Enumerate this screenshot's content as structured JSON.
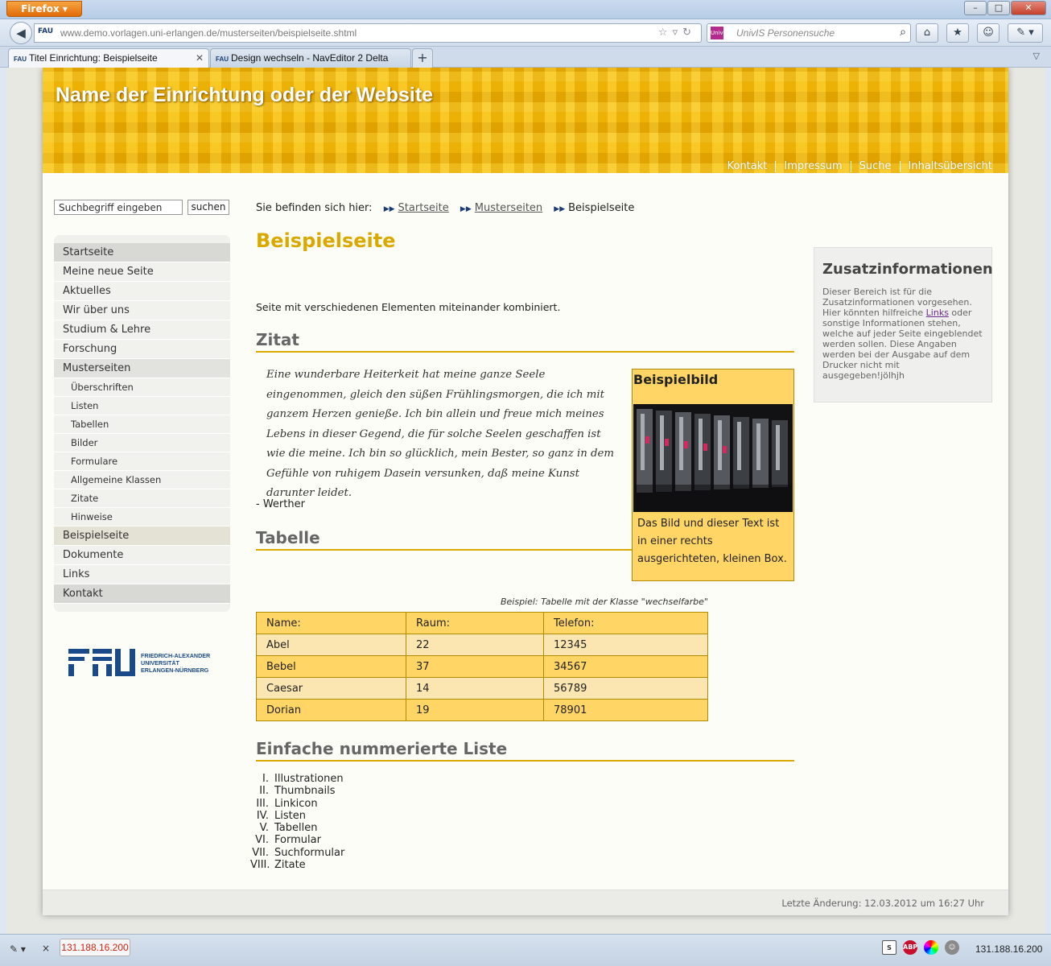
{
  "browser": {
    "menu_button": "Firefox",
    "url_favicon": "FAU",
    "url": "www.demo.vorlagen.uni-erlangen.de/musterseiten/beispielseite.shtml",
    "search_placeholder": "UnivIS Personensuche",
    "tabs": [
      {
        "favicon": "FAU",
        "label": "Titel Einrichtung: Beispielseite",
        "active": true
      },
      {
        "favicon": "FAU",
        "label": "Design wechseln - NavEditor 2 Delta",
        "active": false
      }
    ],
    "new_tab": "+",
    "window_buttons": {
      "minimize": "–",
      "maximize": "□",
      "close": "✕"
    }
  },
  "site": {
    "title": "Name der Einrichtung oder der Website",
    "metanav": [
      "Kontakt",
      "Impressum",
      "Suche",
      "Inhaltsübersicht"
    ]
  },
  "search": {
    "placeholder": "Suchbegriff eingeben",
    "button": "suchen"
  },
  "sidenav": [
    {
      "label": "Startseite",
      "level": "top"
    },
    {
      "label": "Meine neue Seite",
      "level": "main"
    },
    {
      "label": "Aktuelles",
      "level": "main"
    },
    {
      "label": "Wir über uns",
      "level": "main"
    },
    {
      "label": "Studium & Lehre",
      "level": "main"
    },
    {
      "label": "Forschung",
      "level": "main"
    },
    {
      "label": "Musterseiten",
      "level": "open"
    },
    {
      "label": "Überschriften",
      "level": "sub"
    },
    {
      "label": "Listen",
      "level": "sub"
    },
    {
      "label": "Tabellen",
      "level": "sub"
    },
    {
      "label": "Bilder",
      "level": "sub"
    },
    {
      "label": "Formulare",
      "level": "sub"
    },
    {
      "label": "Allgemeine Klassen",
      "level": "sub"
    },
    {
      "label": "Zitate",
      "level": "sub"
    },
    {
      "label": "Hinweise",
      "level": "sub"
    },
    {
      "label": "Beispielseite",
      "level": "current"
    },
    {
      "label": "Dokumente",
      "level": "main"
    },
    {
      "label": "Links",
      "level": "main"
    },
    {
      "label": "Kontakt",
      "level": "top"
    }
  ],
  "logo": {
    "letters": "FAU",
    "line1": "FRIEDRICH-ALEXANDER",
    "line2": "UNIVERSITÄT",
    "line3": "ERLANGEN-NÜRNBERG"
  },
  "breadcrumb": {
    "prefix": "Sie befinden sich hier:",
    "items": [
      "Startseite",
      "Musterseiten"
    ],
    "current": "Beispielseite"
  },
  "main": {
    "title": "Beispielseite",
    "intro": "Seite mit verschiedenen Elementen miteinander kombiniert.",
    "h_quote": "Zitat",
    "quote": "Eine wunderbare Heiterkeit hat meine ganze Seele eingenommen, gleich den süßen Frühlingsmorgen, die ich mit ganzem Herzen genieße. Ich bin allein und freue mich meines Lebens in dieser Gegend, die für solche Seelen geschaffen ist wie die meine. Ich bin so glücklich, mein Bester, so ganz in dem Gefühle von ruhigem Dasein versunken, daß meine Kunst darunter leidet.",
    "quote_author": "- Werther",
    "imagebox_title": "Beispielbild",
    "imagebox_text": "Das Bild und dieser Text ist in einer rechts ausgerichteten, kleinen Box.",
    "h_table": "Tabelle",
    "table_caption": "Beispiel: Tabelle mit der Klasse \"wechselfarbe\"",
    "table_headers": [
      "Name:",
      "Raum:",
      "Telefon:"
    ],
    "table_rows": [
      [
        "Abel",
        "22",
        "12345"
      ],
      [
        "Bebel",
        "37",
        "34567"
      ],
      [
        "Caesar",
        "14",
        "56789"
      ],
      [
        "Dorian",
        "19",
        "78901"
      ]
    ],
    "h_list": "Einfache nummerierte Liste",
    "list_numerals": [
      "I.",
      "II.",
      "III.",
      "IV.",
      "V.",
      "VI.",
      "VII.",
      "VIII."
    ],
    "list": [
      "Illustrationen",
      "Thumbnails",
      "Linkicon",
      "Listen",
      "Tabellen",
      "Formular",
      "Suchformular",
      "Zitate"
    ]
  },
  "infobox": {
    "title": "Zusatzinformationen",
    "text_before": "Dieser Bereich ist für die Zusatzinformationen vorgesehen. Hier könnten hilfreiche ",
    "link": "Links",
    "text_after": " oder sonstige Informationen stehen, welche auf jeder Seite eingeblendet werden sollen. Diese Angaben werden bei der Ausgabe auf dem Drucker nicht mit ausgegeben!jölhjh"
  },
  "footer": {
    "last_modified": "Letzte Änderung: 12.03.2012 um 16:27 Uhr"
  },
  "statusbar": {
    "ip_box": "131.188.16.200",
    "ip_right": "131.188.16.200",
    "close": "×"
  },
  "colors": {
    "accent": "#d9a900",
    "table_odd": "#ffd565",
    "table_even": "#fbe6b1"
  }
}
